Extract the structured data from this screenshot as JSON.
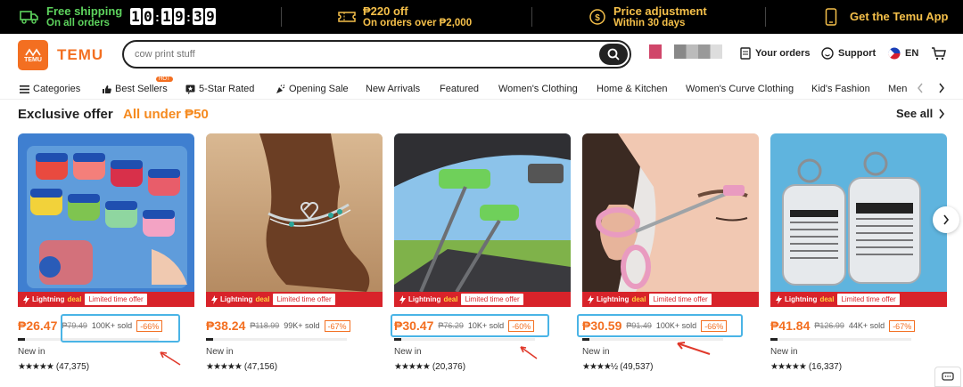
{
  "topbar": {
    "shipping": {
      "title": "Free shipping",
      "sub": "On all orders"
    },
    "timer": [
      "1",
      "0",
      "1",
      "9",
      "3",
      "9"
    ],
    "promo": {
      "title": "₱220 off",
      "sub": "On orders over ₱2,000"
    },
    "price_adj": {
      "title": "Price adjustment",
      "sub": "Within 30 days"
    },
    "app": {
      "title": "Get the Temu App"
    }
  },
  "header": {
    "logo_text": "TEMU",
    "logo_mini": "TEMU",
    "search_placeholder": "cow print stuff",
    "orders": "Your orders",
    "support": "Support",
    "lang": "EN"
  },
  "nav": {
    "categories": "Categories",
    "best_sellers": "Best Sellers",
    "hot_badge": "HOT",
    "five_star": "5-Star Rated",
    "opening_sale": "Opening Sale",
    "new_arrivals": "New Arrivals",
    "featured": "Featured",
    "womens_clothing": "Women's Clothing",
    "home_kitchen": "Home & Kitchen",
    "womens_curve": "Women's Curve Clothing",
    "kids_fashion": "Kid's Fashion",
    "men": "Men"
  },
  "section": {
    "title": "Exclusive offer",
    "subtitle": "All under ₱50",
    "see_all": "See all"
  },
  "deal": {
    "label": "Lightning",
    "label_deal": "deal",
    "limited": "Limited time offer"
  },
  "products": [
    {
      "price": "₱26.47",
      "orig": "₱79.49",
      "sold": "100K+ sold",
      "discount": "-66%",
      "progress": 0.05,
      "status": "New in",
      "reviews": "(47,375)",
      "stars": "★★★★★"
    },
    {
      "price": "₱38.24",
      "orig": "₱118.99",
      "sold": "99K+ sold",
      "discount": "-67%",
      "progress": 0.05,
      "status": "New in",
      "reviews": "(47,156)",
      "stars": "★★★★★"
    },
    {
      "price": "₱30.47",
      "orig": "₱76.29",
      "sold": "10K+ sold",
      "discount": "-60%",
      "progress": 0.05,
      "status": "New in",
      "reviews": "(20,376)",
      "stars": "★★★★★"
    },
    {
      "price": "₱30.59",
      "orig": "₱91.49",
      "sold": "100K+ sold",
      "discount": "-66%",
      "progress": 0.05,
      "status": "New in",
      "reviews": "(49,537)",
      "stars": "★★★★½"
    },
    {
      "price": "₱41.84",
      "orig": "₱126.99",
      "sold": "44K+ sold",
      "discount": "-67%",
      "progress": 0.05,
      "status": "New in",
      "reviews": "(16,337)",
      "stars": "★★★★★"
    }
  ],
  "colors": {
    "brand": "#f36f21",
    "deal_red": "#d8232a",
    "highlight": "#4ab4e6",
    "arrow": "#e0392b"
  }
}
